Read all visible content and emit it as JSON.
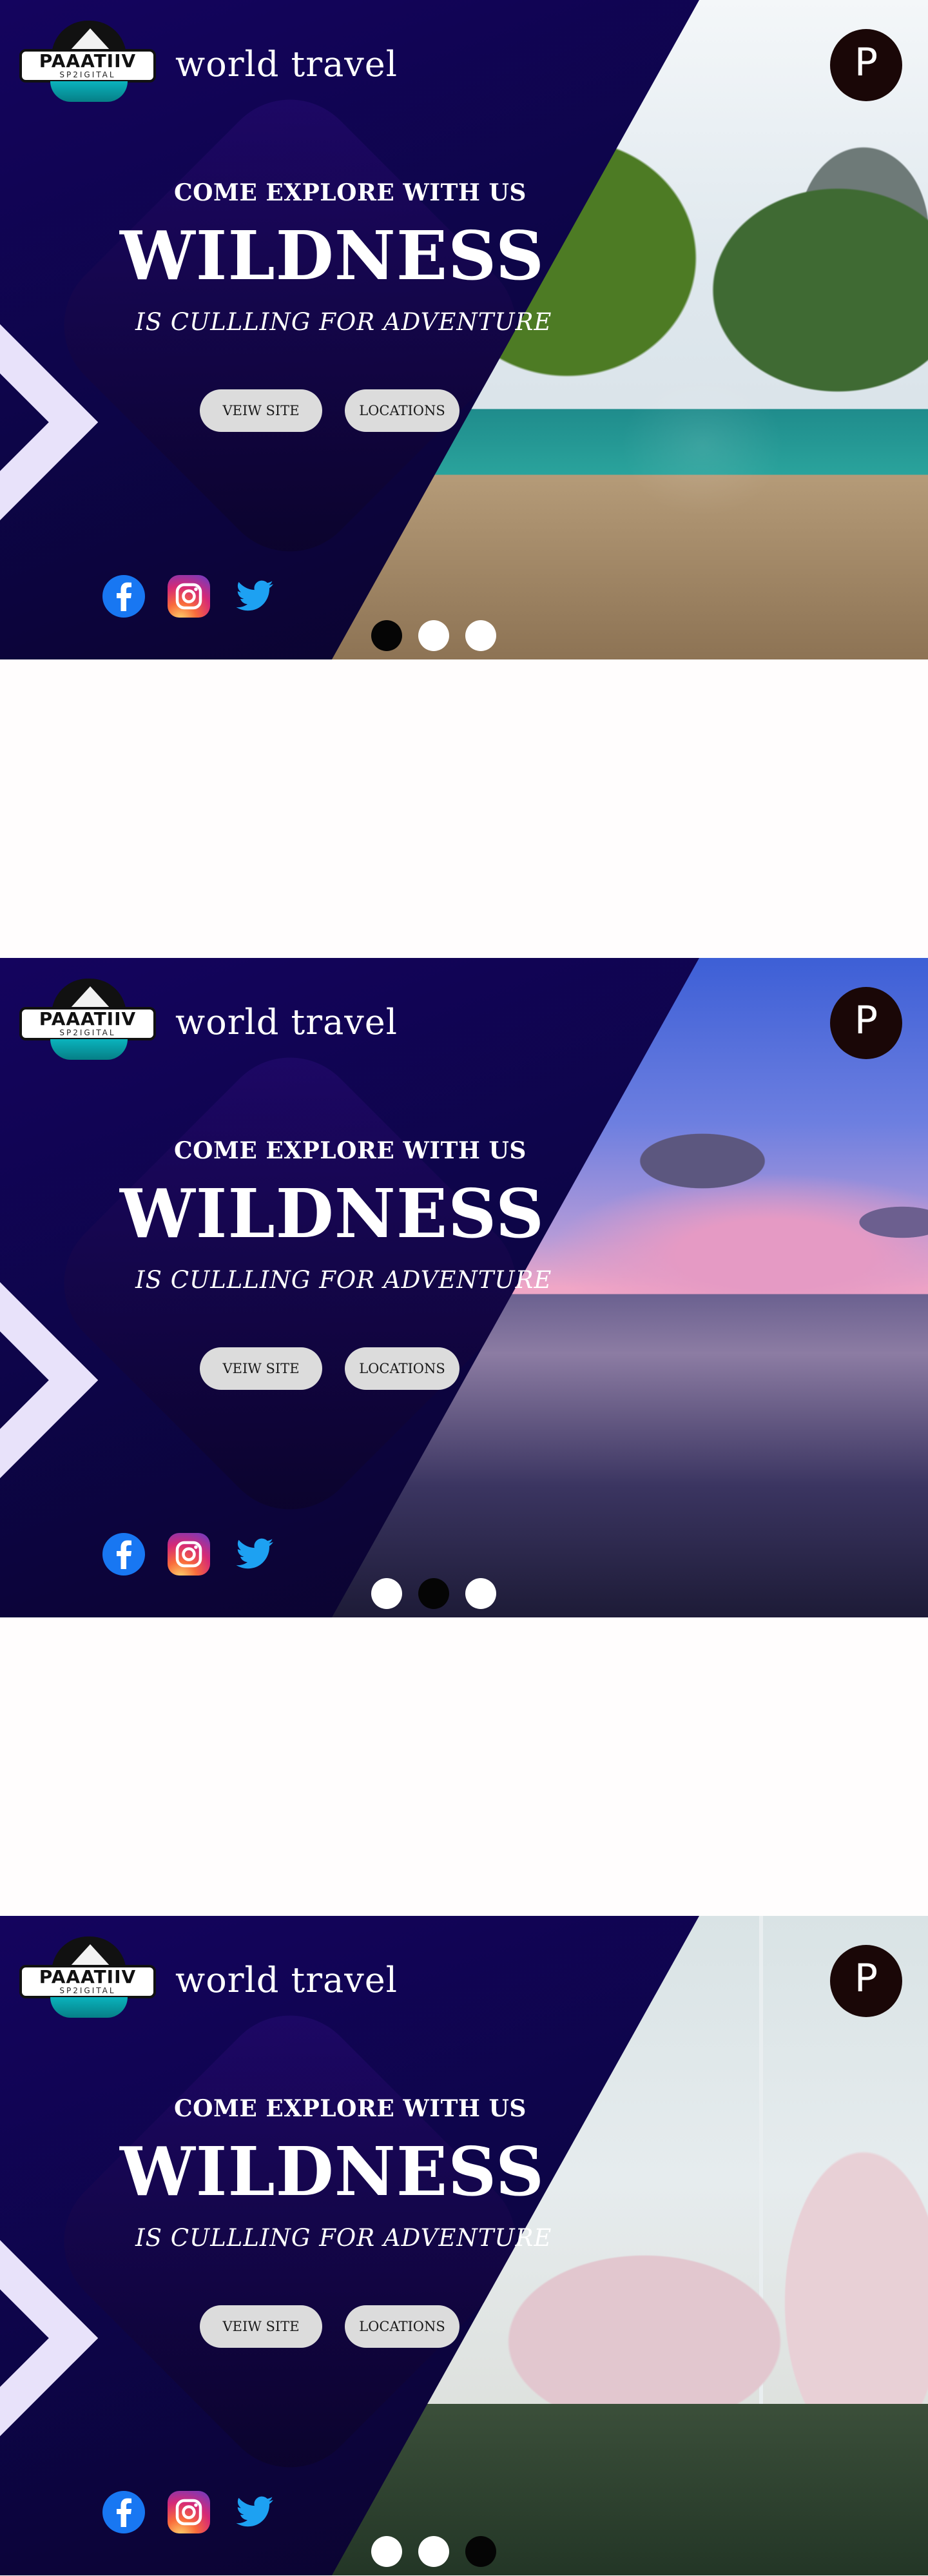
{
  "header": {
    "logo": {
      "title": "PAAATIIV",
      "subtitle": "SP2IGITAL"
    },
    "brand": "world travel",
    "profile_initial": "P"
  },
  "hero": {
    "eyebrow": "COME EXPLORE WITH US",
    "headline": "WILDNESS",
    "tagline": "IS CULLLING FOR ADVENTURE",
    "buttons": {
      "view_site": "VEIW SITE",
      "locations": "LOCATIONS"
    }
  },
  "social": [
    "facebook-icon",
    "instagram-icon",
    "twitter-icon"
  ],
  "slides": [
    {
      "scene": "boat-in-bay",
      "active_dot": 1
    },
    {
      "scene": "lake-sunset",
      "active_dot": 2
    },
    {
      "scene": "canal-cherry-blossom",
      "active_dot": 3
    }
  ],
  "colors": {
    "panel": "#0d0548",
    "chevron": "#e8e2fa",
    "button": "#dcdcdc",
    "profile": "#1a0707",
    "facebook": "#1877f2",
    "twitter": "#1da1f2"
  }
}
